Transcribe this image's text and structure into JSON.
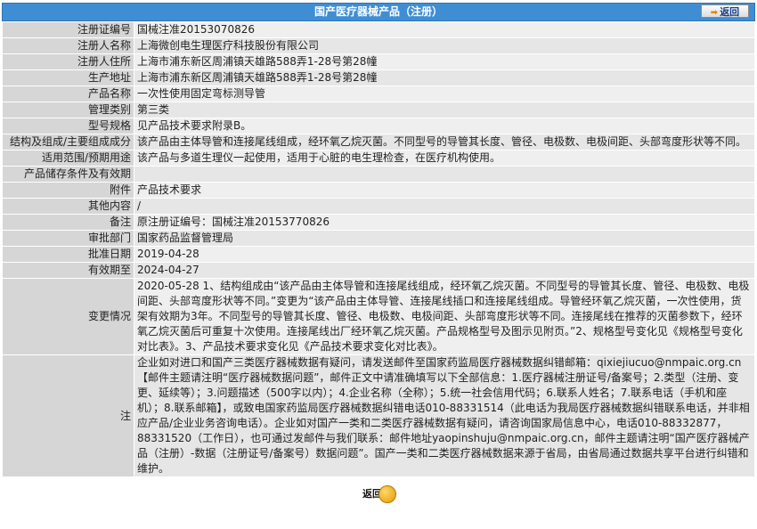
{
  "header": {
    "title": "国产医疗器械产品（注册）",
    "back_label": "返回"
  },
  "rows": [
    {
      "label": "注册证编号",
      "value": "国械注准20153070826"
    },
    {
      "label": "注册人名称",
      "value": "上海微创电生理医疗科技股份有限公司"
    },
    {
      "label": "注册人住所",
      "value": "上海市浦东新区周浦镇天雄路588弄1-28号第28幢"
    },
    {
      "label": "生产地址",
      "value": "上海市浦东新区周浦镇天雄路588弄1-28号第28幢"
    },
    {
      "label": "产品名称",
      "value": "一次性使用固定弯标测导管"
    },
    {
      "label": "管理类别",
      "value": "第三类"
    },
    {
      "label": "型号规格",
      "value": "见产品技术要求附录B。"
    },
    {
      "label": "结构及组成/主要组成成分",
      "value": "该产品由主体导管和连接尾线组成，经环氧乙烷灭菌。不同型号的导管其长度、管径、电极数、电极间距、头部弯度形状等不同。"
    },
    {
      "label": "适用范围/预期用途",
      "value": "该产品与多道生理仪一起使用，适用于心脏的电生理检查，在医疗机构使用。"
    },
    {
      "label": "产品储存条件及有效期",
      "value": ""
    },
    {
      "label": "附件",
      "value": "产品技术要求"
    },
    {
      "label": "其他内容",
      "value": "/"
    },
    {
      "label": "备注",
      "value": "原注册证编号：国械注准20153770826"
    },
    {
      "label": "审批部门",
      "value": "国家药品监督管理局"
    },
    {
      "label": "批准日期",
      "value": "2019-04-28"
    },
    {
      "label": "有效期至",
      "value": "2024-04-27"
    },
    {
      "label": "变更情况",
      "value": "2020-05-28 1、结构组成由“该产品由主体导管和连接尾线组成，经环氧乙烷灭菌。不同型号的导管其长度、管径、电极数、电极间距、头部弯度形状等不同。”变更为“该产品由主体导管、连接尾线插口和连接尾线组成。导管经环氧乙烷灭菌，一次性使用，货架有效期为3年。不同型号的导管其长度、管径、电极数、电极间距、头部弯度形状等不同。连接尾线在推荐的灭菌参数下，经环氧乙烷灭菌后可重复十次使用。连接尾线出厂经环氧乙烷灭菌。产品规格型号及图示见附页。”2、规格型号变化见《规格型号变化对比表》。3、产品技术要求变化见《产品技术要求变化对比表》。"
    },
    {
      "label": "注",
      "value": "企业如对进口和国产三类医疗器械数据有疑问，请发送邮件至国家药监局医疗器械数据纠错邮箱：qixiejiucuo@nmpaic.org.cn【邮件主题请注明“医疗器械数据问题”，邮件正文中请准确填写以下全部信息：1.医疗器械注册证号/备案号；2.类型（注册、变更、延续等）；3.问题描述（500字以内）；4.企业名称（全称）；5.统一社会信用代码；6.联系人姓名；7.联系电话（手机和座机）；8.联系邮箱】，或致电国家药监局医疗器械数据纠错电话010-88331514（此电话为我局医疗器械数据纠错联系电话，并非相应产品/企业业务咨询电话）。企业如对国产一类和二类医疗器械数据有疑问，请咨询国家局信息中心，电话010-88332877，88331520（工作日），也可通过发邮件与我们联系：邮件地址yaopinshuju@nmpaic.org.cn，邮件主题请注明“国产医疗器械产品（注册）-数据（注册证号/备案号）数据问题”。国产一类和二类医疗器械数据来源于省局，由省局通过数据共享平台进行纠错和维护。"
    }
  ],
  "footer": {
    "back_label": "返回"
  },
  "colors": {
    "header_bg": "#3f8ed4",
    "label_bg": "#d6d6d6",
    "value_bg": "#efefef"
  }
}
